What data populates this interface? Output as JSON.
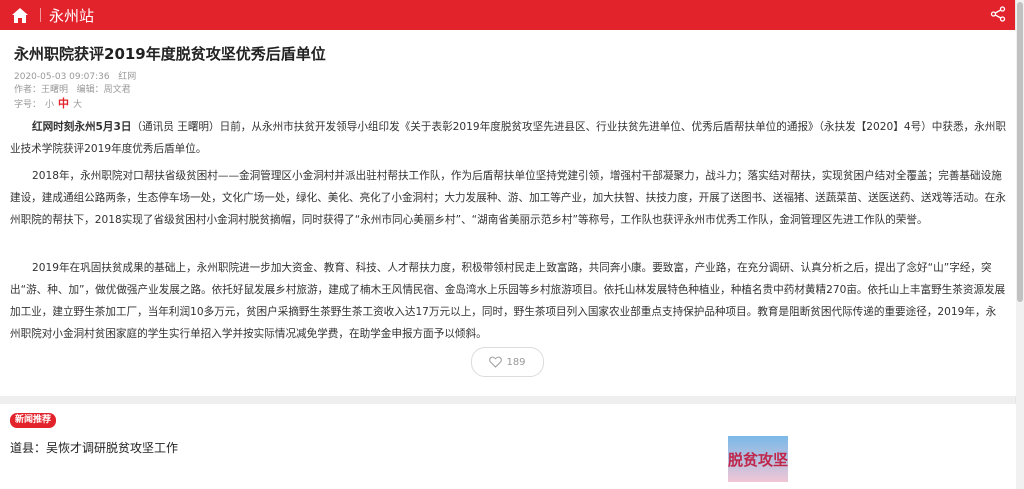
{
  "header": {
    "station": "永州站",
    "home_icon": "home-icon",
    "share_icon": "share-icon",
    "bar_color": "#e3232c"
  },
  "article": {
    "title": "永州职院获评2019年度脱贫攻坚优秀后盾单位",
    "datetime": "2020-05-03 09:07:36",
    "source": "红网",
    "author": "作者：王曙明",
    "editor": "编辑：周文君",
    "font_size_label": "字号：",
    "font_sizes": {
      "small": "小",
      "medium": "中",
      "large": "大"
    },
    "p1_lead": "红网时刻永州5月3日",
    "p1_rest": "（通讯员 王曙明）日前，从永州市扶贫开发领导小组印发《关于表彰2019年度脱贫攻坚先进县区、行业扶贫先进单位、优秀后盾帮扶单位的通报》（永扶发【2020】4号）中获悉，永州职业技术学院获评2019年度优秀后盾单位。",
    "p2": "2018年，永州职院对口帮扶省级贫困村——金洞管理区小金洞村并派出驻村帮扶工作队，作为后盾帮扶单位坚持党建引领，增强村干部凝聚力，战斗力；落实结对帮扶，实现贫困户结对全覆盖；完善基础设施建设，建成通组公路两条，生态停车场一处，文化广场一处，绿化、美化、亮化了小金洞村；大力发展种、游、加工等产业，加大扶智、扶技力度，开展了送图书、送福猪、送蔬菜苗、送医送药、送戏等活动。在永州职院的帮扶下，2018实现了省级贫困村小金洞村脱贫摘帽，同时获得了“永州市同心美丽乡村”、“湖南省美丽示范乡村”等称号，工作队也获评永州市优秀工作队，金洞管理区先进工作队的荣誉。",
    "p3": "2019年在巩固扶贫成果的基础上，永州职院进一步加大资金、教育、科技、人才帮扶力度，积极带领村民走上致富路，共同奔小康。要致富，产业路，在充分调研、认真分析之后，提出了念好“山”字经，突出“游、种、加”，做优做强产业发展之路。依托好鼠发展乡村旅游，建成了楠木王风情民宿、金岛湾水上乐园等乡村旅游项目。依托山林发展特色种植业，种植名贵中药材黄精270亩。依托山上丰富野生茶资源发展加工业，建立野生茶加工厂，当年利润10多万元，贫困户采摘野生茶野生茶工资收入达17万元以上，同时，野生茶项目列入国家农业部重点支持保护品种项目。教育是阻断贫困代际传递的重要途径，2019年，永州职院对小金洞村贫困家庭的学生实行单招入学并按实际情况减免学费，在助学金申报方面予以倾斜。",
    "likes": "189",
    "like_icon": "heart-icon"
  },
  "recommend": {
    "badge": "新闻推荐",
    "item_title": "道县：吴恢才调研脱贫攻坚工作",
    "thumb_text": "脱贫攻坚"
  }
}
